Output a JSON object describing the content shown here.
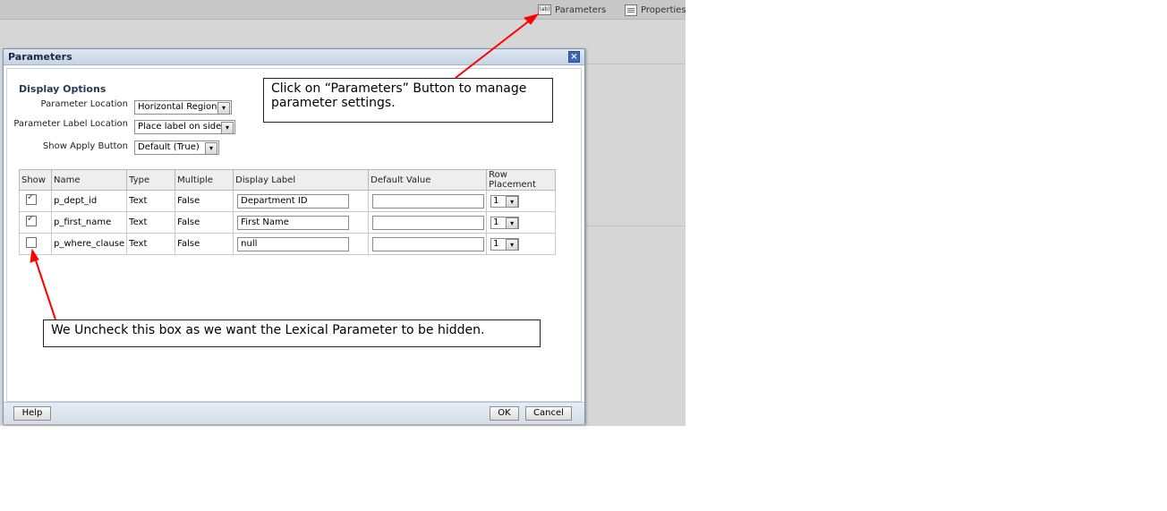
{
  "toolbar": {
    "parameters_label": "Parameters",
    "parameters_icon_text": "(ab)",
    "properties_label": "Properties"
  },
  "dialog": {
    "title": "Parameters",
    "close_glyph": "×",
    "display_options": {
      "heading": "Display Options",
      "parameter_location": {
        "label": "Parameter Location",
        "value": "Horizontal Region"
      },
      "parameter_label_location": {
        "label": "Parameter Label Location",
        "value": "Place label on side"
      },
      "show_apply_button": {
        "label": "Show Apply Button",
        "value": "Default (True)"
      }
    },
    "table": {
      "columns": [
        "Show",
        "Name",
        "Type",
        "Multiple",
        "Display Label",
        "Default Value",
        "Row Placement"
      ],
      "rows": [
        {
          "show": true,
          "name": "p_dept_id",
          "type": "Text",
          "multiple": "False",
          "display_label": "Department ID",
          "default_value": "",
          "row_placement": "1"
        },
        {
          "show": true,
          "name": "p_first_name",
          "type": "Text",
          "multiple": "False",
          "display_label": "First Name",
          "default_value": "",
          "row_placement": "1"
        },
        {
          "show": false,
          "name": "p_where_clause",
          "type": "Text",
          "multiple": "False",
          "display_label": "null",
          "default_value": "",
          "row_placement": "1"
        }
      ]
    },
    "buttons": {
      "help": "Help",
      "ok": "OK",
      "cancel": "Cancel"
    }
  },
  "annotations": {
    "callout_parameters": "Click on “Parameters” Button to manage parameter settings.",
    "callout_uncheck": "We Uncheck this box as we want the Lexical Parameter to be hidden.",
    "arrow_color": "#ff0000"
  },
  "dropdown_glyph": "▾"
}
